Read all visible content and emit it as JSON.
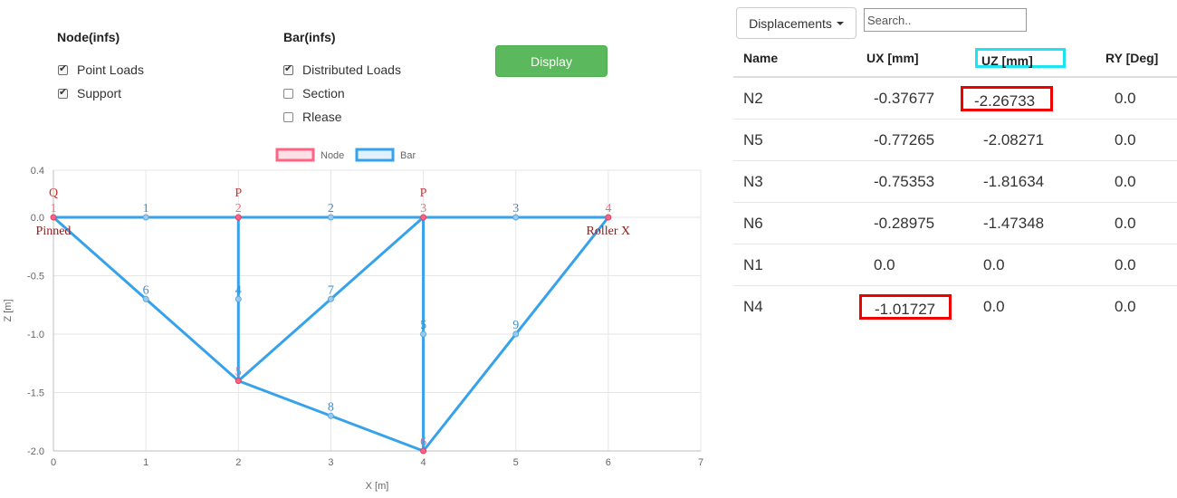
{
  "options": {
    "node_group": {
      "title": "Node(infs)",
      "items": [
        {
          "label": "Point Loads",
          "checked": true
        },
        {
          "label": "Support",
          "checked": true
        }
      ]
    },
    "bar_group": {
      "title": "Bar(infs)",
      "items": [
        {
          "label": "Distributed Loads",
          "checked": true
        },
        {
          "label": "Section",
          "checked": false
        },
        {
          "label": "Rlease",
          "checked": false
        }
      ]
    },
    "display_button": "Display"
  },
  "chart_data": {
    "type": "scatter",
    "xlabel": "X [m]",
    "ylabel": "Z [m]",
    "xlim": [
      0,
      7
    ],
    "ylim": [
      -2.0,
      0.4
    ],
    "x_ticks": [
      "0",
      "1",
      "2",
      "3",
      "4",
      "5",
      "6",
      "7"
    ],
    "y_ticks": [
      "0.4",
      "0.0",
      "-0.5",
      "-1.0",
      "-1.5",
      "-2.0"
    ],
    "grid": true,
    "legend_position": "top",
    "legend": [
      {
        "name": "Node",
        "color": "#ff6384"
      },
      {
        "name": "Bar",
        "color": "#36a2eb"
      }
    ],
    "nodes": [
      {
        "x": 0,
        "z": 0,
        "label": "1"
      },
      {
        "x": 2,
        "z": 0,
        "label": "2"
      },
      {
        "x": 4,
        "z": 0,
        "label": "3"
      },
      {
        "x": 6,
        "z": 0,
        "label": "4"
      },
      {
        "x": 2,
        "z": -1.4,
        "label": "5"
      },
      {
        "x": 4,
        "z": -2.0,
        "label": "6"
      }
    ],
    "bars": [
      {
        "from": [
          0,
          0
        ],
        "to": [
          2,
          0
        ],
        "label": "1",
        "mid": [
          1,
          0
        ]
      },
      {
        "from": [
          2,
          0
        ],
        "to": [
          4,
          0
        ],
        "label": "2",
        "mid": [
          3,
          0
        ]
      },
      {
        "from": [
          4,
          0
        ],
        "to": [
          6,
          0
        ],
        "label": "3",
        "mid": [
          5,
          0
        ]
      },
      {
        "from": [
          2,
          0
        ],
        "to": [
          2,
          -1.4
        ],
        "label": "4",
        "mid": [
          2,
          -0.7
        ]
      },
      {
        "from": [
          4,
          0
        ],
        "to": [
          4,
          -2.0
        ],
        "label": "5",
        "mid": [
          4,
          -1.0
        ]
      },
      {
        "from": [
          0,
          0
        ],
        "to": [
          2,
          -1.4
        ],
        "label": "6",
        "mid": [
          1,
          -0.7
        ]
      },
      {
        "from": [
          2,
          -1.4
        ],
        "to": [
          4,
          0
        ],
        "label": "7",
        "mid": [
          3,
          -0.7
        ]
      },
      {
        "from": [
          2,
          -1.4
        ],
        "to": [
          4,
          -2.0
        ],
        "label": "8",
        "mid": [
          3,
          -1.7
        ]
      },
      {
        "from": [
          4,
          -2.0
        ],
        "to": [
          6,
          0
        ],
        "label": "9",
        "mid": [
          5,
          -1.0
        ]
      }
    ],
    "annotations": [
      {
        "text": "Q",
        "x": 0,
        "z": 0,
        "color": "#cc3333",
        "pos": "above-top"
      },
      {
        "text": "P",
        "x": 2,
        "z": 0,
        "color": "#cc3333",
        "pos": "above-top"
      },
      {
        "text": "P",
        "x": 4,
        "z": 0,
        "color": "#cc3333",
        "pos": "above-top"
      },
      {
        "text": "Pinned",
        "x": 0,
        "z": 0,
        "color": "#8b1a1a",
        "pos": "below"
      },
      {
        "text": "Roller X",
        "x": 6,
        "z": 0,
        "color": "#8b1a1a",
        "pos": "below"
      }
    ]
  },
  "results": {
    "dropdown_label": "Displacements",
    "search_placeholder": "Search..",
    "columns": [
      "Name",
      "UX [mm]",
      "UZ [mm]",
      "RY [Deg]"
    ],
    "rows": [
      [
        "N2",
        "-0.37677",
        "-2.26733",
        "0.0"
      ],
      [
        "N5",
        "-0.77265",
        "-2.08271",
        "0.0"
      ],
      [
        "N3",
        "-0.75353",
        "-1.81634",
        "0.0"
      ],
      [
        "N6",
        "-0.28975",
        "-1.47348",
        "0.0"
      ],
      [
        "N1",
        "0.0",
        "0.0",
        "0.0"
      ],
      [
        "N4",
        "-1.01727",
        "0.0",
        "0.0"
      ]
    ],
    "highlight_color": "#ee0000",
    "header_highlight_color": "#1de3ef"
  }
}
